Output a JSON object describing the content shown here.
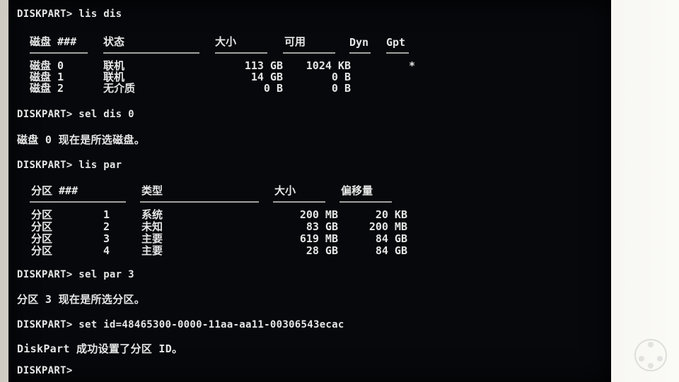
{
  "console": {
    "cmd1": "DISKPART> lis dis",
    "cmd2": "DISKPART> sel dis 0",
    "msg2": "磁盘 0 现在是所选磁盘。",
    "cmd3": "DISKPART> lis par",
    "cmd4": "DISKPART> sel par 3",
    "msg4": "分区 3 现在是所选分区。",
    "cmd5": "DISKPART> set id=48465300-0000-11aa-aa11-00306543ecac",
    "msg5": "DiskPart 成功设置了分区 ID。",
    "prompt": "DISKPART>"
  },
  "disk_table": {
    "headers": [
      "磁盘 ###",
      "状态",
      "大小",
      "可用",
      "Dyn",
      "Gpt"
    ],
    "rows": [
      [
        "磁盘 0",
        "联机",
        "113 GB",
        "1024 KB",
        "",
        "*"
      ],
      [
        "磁盘 1",
        "联机",
        "14 GB",
        "0 B",
        "",
        ""
      ],
      [
        "磁盘 2",
        "无介质",
        "0 B",
        "0 B",
        "",
        ""
      ]
    ]
  },
  "part_table": {
    "headers": [
      "分区 ###",
      "类型",
      "大小",
      "偏移量"
    ],
    "rows": [
      [
        "分区",
        "1",
        "系统",
        "200 MB",
        "20 KB"
      ],
      [
        "分区",
        "2",
        "未知",
        "83 GB",
        "200 MB"
      ],
      [
        "分区",
        "3",
        "主要",
        "619 MB",
        "84 GB"
      ],
      [
        "分区",
        "4",
        "主要",
        "28 GB",
        "84 GB"
      ]
    ]
  }
}
